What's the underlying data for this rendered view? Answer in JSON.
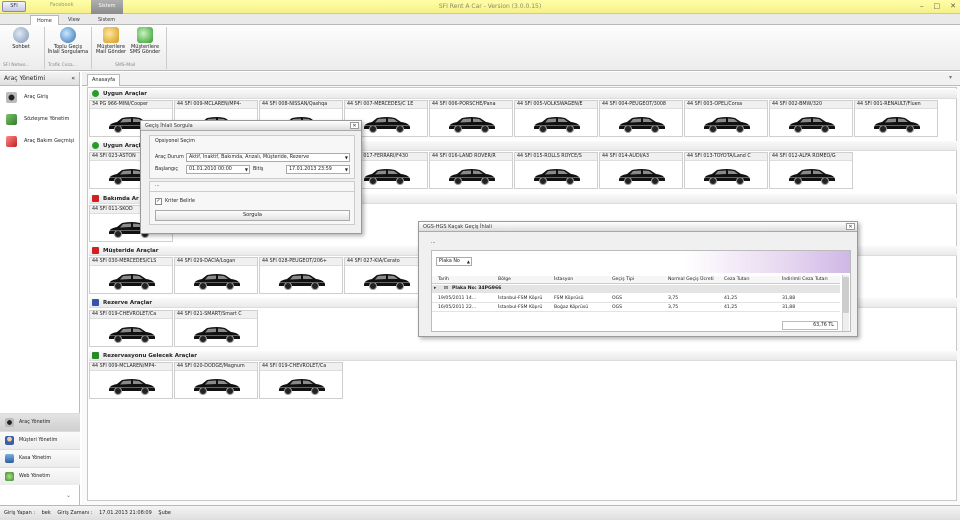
{
  "window": {
    "title": "SFI Rent A Car - Version (3.0.0.15)",
    "orb_label": "SFI",
    "quick_access": [
      "Facebook"
    ],
    "context_tab": "Sistem",
    "tabs": [
      "Home",
      "View",
      "Sistem"
    ]
  },
  "ribbon": {
    "buttons": [
      {
        "label1": "Sohbet",
        "label2": "",
        "icon": "chat-icon"
      },
      {
        "label1": "Toplu Geçiş",
        "label2": "İhlali Sorgulama",
        "icon": "bridge-icon"
      },
      {
        "label1": "Müşterilere",
        "label2": "Mail Gönder",
        "icon": "mail-icon"
      },
      {
        "label1": "Müşterilere",
        "label2": "SMS Gönder",
        "icon": "sms-icon"
      }
    ],
    "groups": [
      "SFI Netwo...",
      "Trafik Ceza...",
      "SMS-Mail"
    ]
  },
  "left_panel": {
    "header": "Araç Yönetimi",
    "items": [
      "Araç Giriş",
      "Sözleşme Yönetim",
      "Araç Bakım Geçmişi"
    ],
    "nav": [
      "Araç Yönetim",
      "Müşteri Yönetim",
      "Kasa Yönetim",
      "Web Yönetim"
    ]
  },
  "doc_tab": "Anasayfa",
  "sections": [
    {
      "title": "Uygun Araçlar",
      "icon": "check-icon",
      "color": "#2a9a2a",
      "cards": [
        "34 PG 966-MINI/Cooper",
        "44 SFI 009-MCLAREN/MP4-",
        "44 SFI 008-NISSAN/Qashqa",
        "44 SFI 007-MERCEDES/C 1E",
        "44 SFI 006-PORSCHE/Pana",
        "44 SFI 005-VOLKSWAGEN/E",
        "44 SFI 004-PEUGEOT/3008",
        "44 SFI 003-OPEL/Corsa",
        "44 SFI 002-BMW/320",
        "44 SFI 001-RENAULT/Fluen"
      ]
    },
    {
      "title": "Uygun Araçlar",
      "icon": "check-icon",
      "color": "#2a9a2a",
      "cards": [
        "44 SFI 023-ASTON",
        "",
        "",
        "44 SFI 017-FERRARI/F430",
        "44 SFI 016-LAND ROVER/R",
        "44 SFI 015-ROLLS ROYCE/S",
        "44 SFI 014-AUDI/A3",
        "44 SFI 013-TOYOTA/Land C",
        "44 SFI 012-ALFA ROMEO/G"
      ]
    },
    {
      "title": "Bakımda Ar",
      "icon": "wrench-icon",
      "color": "#cc2222",
      "cards": [
        "44 SFI 011-SKOD"
      ]
    },
    {
      "title": "Müşteride Araçlar",
      "icon": "flag-icon",
      "color": "#cc2222",
      "cards": [
        "44 SFI 030-MERCEDES/CLS",
        "44 SFI 029-DACIA/Logan",
        "44 SFI 028-PEUGEOT/206+",
        "44 SFI 027-KIA/Cerato"
      ]
    },
    {
      "title": "Rezerve Araçlar",
      "icon": "calendar-icon",
      "color": "#3355aa",
      "cards": [
        "44 SFI 019-CHEVROLET/Ca",
        "44 SFI 021-SMART/Smart C"
      ]
    },
    {
      "title": "Rezervasyonu Gelecek Araçlar",
      "icon": "calendar-flag-icon",
      "color": "#2a8a2a",
      "cards": [
        "44 SFI 009-MCLAREN/MP4-",
        "44 SFI 020-DODGE/Magnum",
        "44 SFI 019-CHEVROLET/Ca"
      ]
    }
  ],
  "dialog_query": {
    "title": "Geçiş İhlali Sorgula",
    "group_title": "Opsiyonel Seçim",
    "status_label": "Araç Durum",
    "status_value": "Aktif, İnaktif, Bakımda, Arızalı, Müşteride, Rezerve",
    "start_label": "Başlangıç",
    "start_value": "01.01.2010 00:00",
    "end_label": "Bitiş",
    "end_value": "17.01.2013 23:59",
    "separator": "...",
    "checkbox_label": "Kriter Belirle",
    "checkbox_checked": true,
    "button": "Sorgula"
  },
  "dialog_result": {
    "title": "OGS-HGS Kaçak Geçiş İhlali",
    "toolbar": "...",
    "groupby": "Plaka No",
    "columns": [
      "Tarih",
      "Bölge",
      "İstasyon",
      "Geçiş Tipi",
      "Normal Geçiş Ücreti",
      "Ceza Tutarı",
      "İndirimli Ceza Tutarı"
    ],
    "group_label": "Plaka No: 34PG966",
    "rows": [
      [
        "19/05/2011 14...",
        "İstanbul-FSM Köprü",
        "FSM Köprüsü",
        "OGS",
        "3,75",
        "41,25",
        "31,88"
      ],
      [
        "16/05/2011 22...",
        "İstanbul-FSM Köprü",
        "Boğaz Köprüsü",
        "OGS",
        "3,75",
        "41,25",
        "31,88"
      ]
    ],
    "total": "63,76 TL"
  },
  "statusbar": {
    "login_label": "Giriş Yapan :",
    "login_user": "bek",
    "time_label": "Giriş Zamanı :",
    "time_value": "17.01.2013 21:08:09",
    "branch": "Şube"
  }
}
